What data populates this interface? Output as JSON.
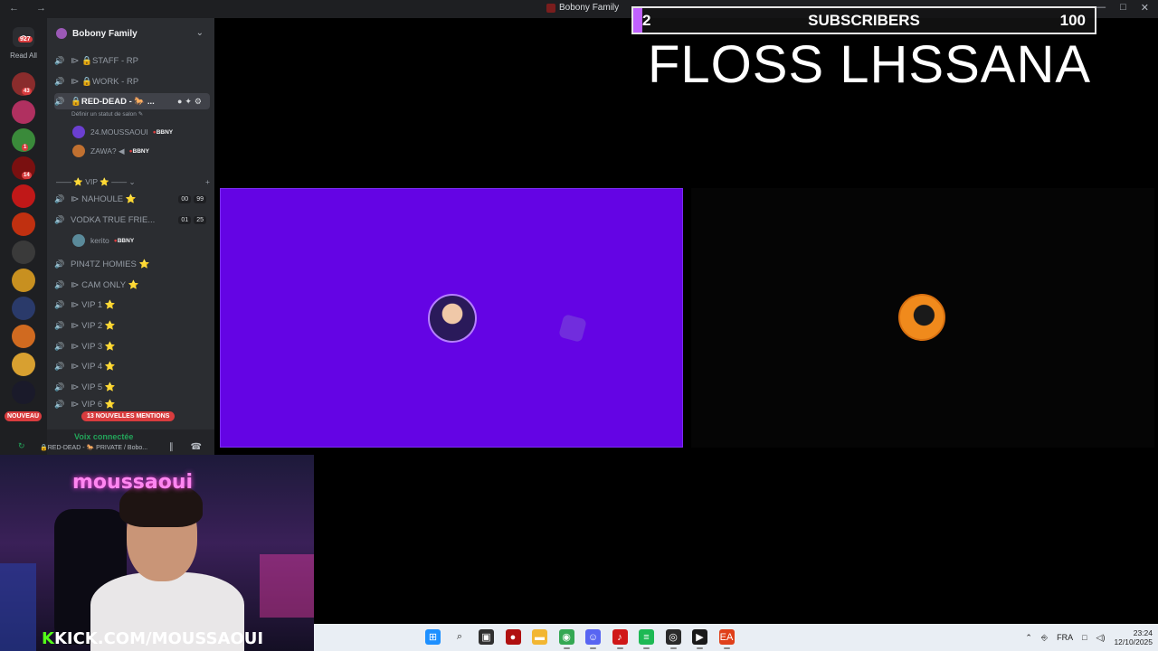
{
  "window": {
    "title": "Bobony Family",
    "nav_glyphs": "← →",
    "controls": [
      "—",
      "□",
      "✕"
    ]
  },
  "rail": {
    "dm_badge": "927",
    "read_all": "Read All",
    "servers": [
      {
        "color": "#8a2c2c",
        "badge": "43"
      },
      {
        "color": "#b03060",
        "badge": ""
      },
      {
        "color": "#3a8a3a",
        "badge": "1"
      },
      {
        "color": "#7a1010",
        "badge": "14"
      },
      {
        "color": "#c01818",
        "badge": ""
      },
      {
        "color": "#c03010",
        "badge": ""
      },
      {
        "color": "#3a3a3a",
        "badge": ""
      },
      {
        "color": "#c89020",
        "badge": ""
      },
      {
        "color": "#2a3a6a",
        "badge": ""
      },
      {
        "color": "#d06a20",
        "badge": ""
      },
      {
        "color": "#d8a030",
        "badge": ""
      },
      {
        "color": "#1a1a2a",
        "badge": ""
      }
    ],
    "nouveau": "NOUVEAU"
  },
  "sidebar": {
    "server_name": "Bobony Family",
    "channels": [
      {
        "name": "⧐ 🔒STAFF - RP",
        "speaker": "off"
      },
      {
        "name": "⧐ 🔒WORK - RP",
        "speaker": "off"
      },
      {
        "name": "🔒RED-DEAD - 🐎 ...",
        "speaker": "on",
        "active": true
      }
    ],
    "active_tools": "●✦⚙",
    "status_hint": "Définir un statut de salon ✎",
    "members_red_dead": [
      {
        "name": "24.MOUSSAOUI",
        "tag": "BBNY",
        "color": "#6b3fd0"
      },
      {
        "name": "ZAWA? ◀",
        "tag": "BBNY",
        "color": "#c07030"
      }
    ],
    "category": "—— ⭐ VIP ⭐ —— ⌄",
    "category_add": "+",
    "channels2": [
      {
        "name": "⧐ NAHOULE ⭐",
        "speaker": "off",
        "counts": [
          "00",
          "99"
        ]
      },
      {
        "name": "VODKA TRUE FRIE...",
        "speaker": "on",
        "counts": [
          "01",
          "25"
        ]
      }
    ],
    "members_vodka": [
      {
        "name": "kerito",
        "tag": "BBNY",
        "color": "#5a8a9a"
      }
    ],
    "channels3": [
      {
        "name": "PIN4TZ HOMIES ⭐",
        "speaker": "off"
      },
      {
        "name": "⧐ CAM ONLY ⭐",
        "speaker": "off"
      },
      {
        "name": "⧐ VIP 1 ⭐",
        "speaker": "off"
      },
      {
        "name": "⧐ VIP 2 ⭐",
        "speaker": "off"
      },
      {
        "name": "⧐ VIP 3 ⭐",
        "speaker": "off"
      },
      {
        "name": "⧐ VIP 4 ⭐",
        "speaker": "off"
      },
      {
        "name": "⧐ VIP 5 ⭐",
        "speaker": "off"
      },
      {
        "name": "⧐ VIP 6 ⭐",
        "speaker": "off"
      }
    ],
    "mentions": "13 NOUVELLES MENTIONS",
    "voice": {
      "title": "Voix connectée",
      "channel": "🔒RED-DEAD - 🐎 PRIVATE / Bobo...",
      "icons": "∥ ☎"
    }
  },
  "overlay": {
    "current": "2",
    "label": "SUBSCRIBERS",
    "goal": "100",
    "progress_fraction": 0.02,
    "headline": "FLOSS LHSSANA"
  },
  "webcam": {
    "neon_sign": "moussaoui",
    "url_k": "K",
    "url_rest": "KICK.COM/MOUSSAOUI"
  },
  "taskbar": {
    "apps": [
      {
        "name": "start-icon",
        "color": "#1e90ff",
        "glyph": "⊞",
        "running": false
      },
      {
        "name": "search-icon",
        "color": "#e9eef4",
        "glyph": "⌕",
        "running": false
      },
      {
        "name": "task-view-icon",
        "color": "#303030",
        "glyph": "▣",
        "running": false
      },
      {
        "name": "record-app-icon",
        "color": "#b01010",
        "glyph": "●",
        "running": false
      },
      {
        "name": "file-explorer-icon",
        "color": "#f2b632",
        "glyph": "▬",
        "running": false
      },
      {
        "name": "chrome-icon",
        "color": "#34a853",
        "glyph": "◉",
        "running": true
      },
      {
        "name": "discord-icon",
        "color": "#5865f2",
        "glyph": "☺",
        "running": true
      },
      {
        "name": "tiktok-studio-icon",
        "color": "#d01818",
        "glyph": "♪",
        "running": true
      },
      {
        "name": "spotify-icon",
        "color": "#1db954",
        "glyph": "≡",
        "running": true
      },
      {
        "name": "obs-icon",
        "color": "#2a2a2a",
        "glyph": "◎",
        "running": true
      },
      {
        "name": "terminal-icon",
        "color": "#1a1a1a",
        "glyph": "▶",
        "running": true
      },
      {
        "name": "ea-app-icon",
        "color": "#e0401a",
        "glyph": "EA",
        "running": true
      }
    ],
    "tray": {
      "chevron": "⌃",
      "mic": "⎆",
      "lang": "FRA",
      "net": "□",
      "vol": "◁)",
      "time": "23:24",
      "date": "12/10/2025"
    }
  }
}
